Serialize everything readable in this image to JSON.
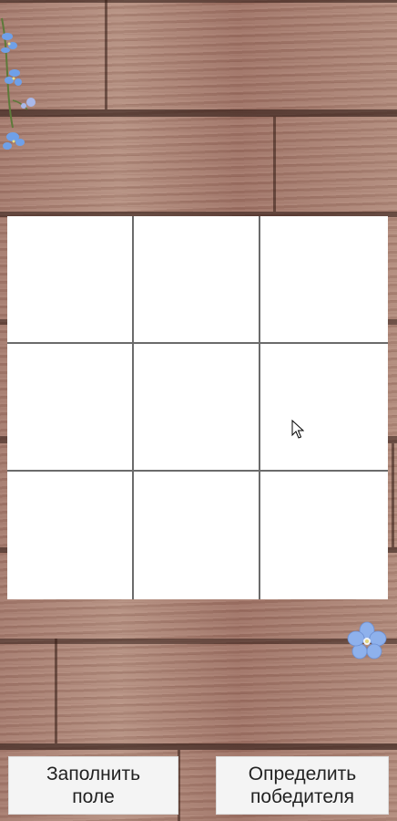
{
  "board": {
    "rows": [
      [
        "",
        "",
        ""
      ],
      [
        "",
        "",
        ""
      ],
      [
        "",
        "",
        ""
      ]
    ]
  },
  "buttons": {
    "fill_field": {
      "line1": "Заполнить",
      "line2": "поле"
    },
    "determine_winner": {
      "line1": "Определить",
      "line2": "победителя"
    }
  },
  "colors": {
    "grid_line": "#6b6b6b",
    "cell_bg": "#ffffff",
    "button_bg": "#f4f4f4",
    "wood": "#a47a6d"
  },
  "icons": [
    "flower-decoration-icon",
    "mouse-pointer-icon"
  ]
}
